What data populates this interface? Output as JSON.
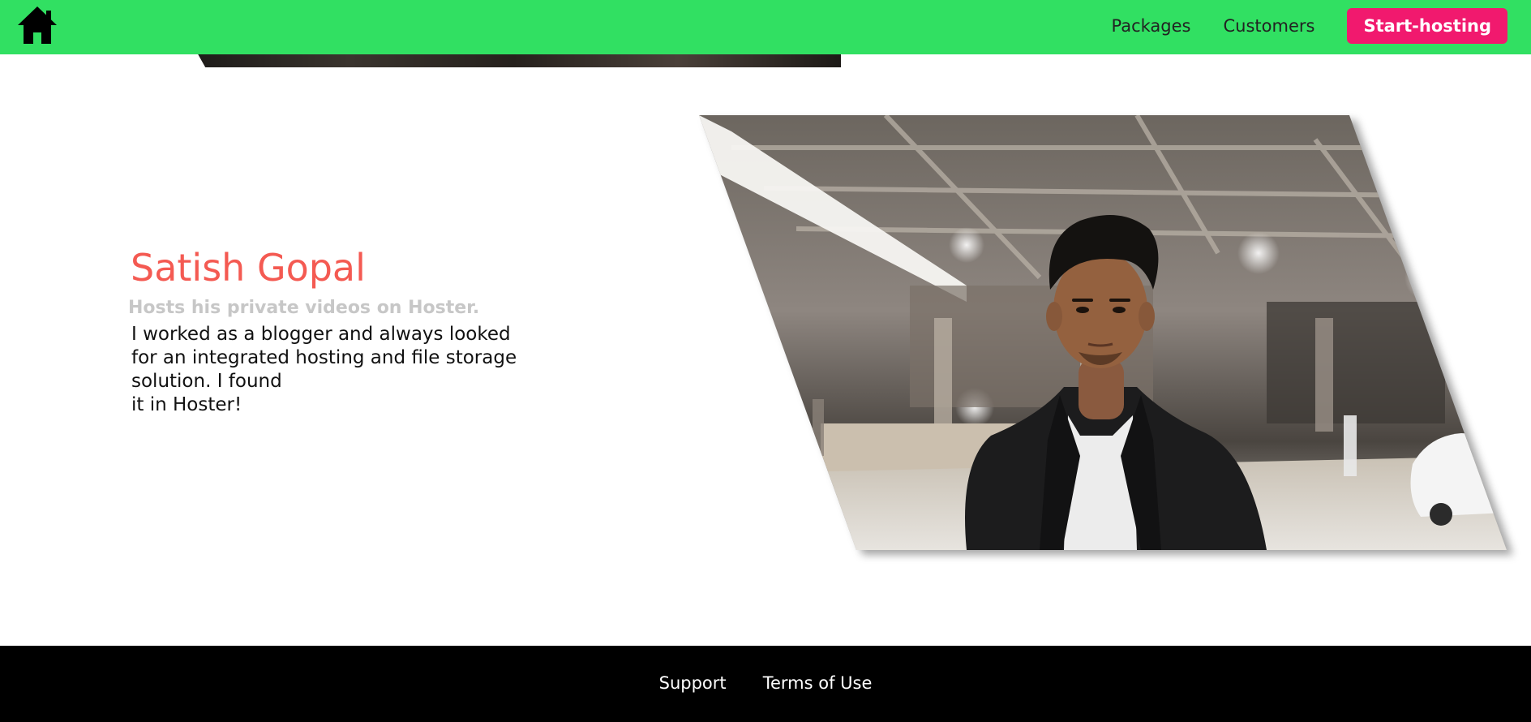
{
  "header": {
    "logo_icon": "home-icon",
    "nav": {
      "packages": "Packages",
      "customers": "Customers",
      "cta": "Start-hosting"
    }
  },
  "testimonial": {
    "name": "Satish Gopal",
    "tagline": "Hosts his private videos on Hoster.",
    "quote_lines": [
      "I worked as a blogger and always looked",
      "for an integrated hosting and file storage",
      "solution. I found",
      "it in Hoster!"
    ]
  },
  "footer": {
    "support": "Support",
    "terms": "Terms of Use"
  },
  "colors": {
    "header_bg": "#31e062",
    "cta_bg": "#f1196e",
    "name_color": "#f45a52",
    "tagline_color": "#c7c7c7",
    "footer_bg": "#000000"
  }
}
